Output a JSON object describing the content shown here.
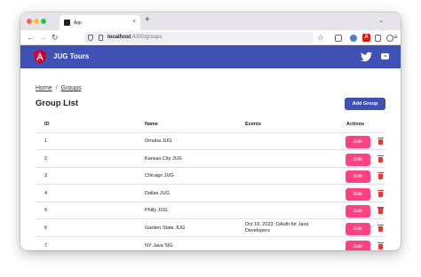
{
  "browser": {
    "tab_title": "App",
    "tab_close": "×",
    "new_tab": "+",
    "tab_menu": "⌄",
    "nav_back": "←",
    "nav_forward": "→",
    "nav_reload": "↻",
    "url_host": "localhost",
    "url_rest": ":4200/groups",
    "bookmark_star": "☆",
    "extension_badge": "A"
  },
  "appbar": {
    "title": "JUG Tours",
    "brand_color": "#3f51b5"
  },
  "breadcrumb": {
    "home": "Home",
    "separator": "/",
    "current": "Groups"
  },
  "page": {
    "title": "Group List",
    "add_button": "Add Group"
  },
  "table": {
    "headers": {
      "id": "ID",
      "name": "Name",
      "events": "Events",
      "actions": "Actions"
    },
    "edit_label": "Edit",
    "rows": [
      {
        "id": "1",
        "name": "Omaha JUG",
        "events": ""
      },
      {
        "id": "2",
        "name": "Kansas City JUG",
        "events": ""
      },
      {
        "id": "3",
        "name": "Chicago JUG",
        "events": ""
      },
      {
        "id": "4",
        "name": "Dallas JUG",
        "events": ""
      },
      {
        "id": "5",
        "name": "Philly JUG",
        "events": ""
      },
      {
        "id": "6",
        "name": "Garden State JUG",
        "events": "Oct 18, 2023: OAuth for Java Developers"
      },
      {
        "id": "7",
        "name": "NY Java SIG",
        "events": ""
      }
    ]
  },
  "colors": {
    "edit_button": "#ff4081",
    "delete_icon": "#e53935"
  }
}
